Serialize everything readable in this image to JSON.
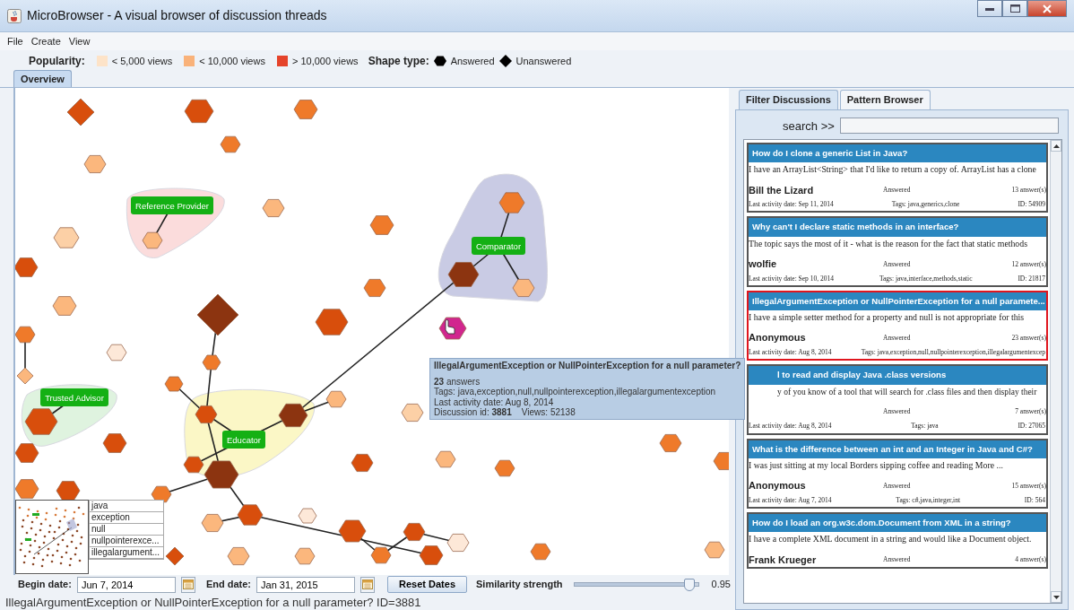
{
  "window": {
    "title": "MicroBrowser - A visual browser of discussion threads"
  },
  "menu": [
    "File",
    "Create",
    "View"
  ],
  "legend": {
    "popularity_label": "Popularity:",
    "popularity": [
      {
        "label": "< 5,000 views",
        "color": "#fde3c8"
      },
      {
        "label": "< 10,000 views",
        "color": "#f9b27a"
      },
      {
        "label": "> 10,000 views",
        "color": "#e5432a"
      }
    ],
    "shape_label": "Shape type:",
    "shapes": [
      {
        "kind": "hexagon",
        "label": "Answered"
      },
      {
        "kind": "diamond",
        "label": "Unanswered"
      }
    ]
  },
  "tabs": [
    {
      "label": "Overview",
      "selected": true
    }
  ],
  "graph": {
    "clusters": [
      {
        "label": "Reference Provider",
        "color": "#fbdcdc"
      },
      {
        "label": "Comparator",
        "color": "#c9cbe4"
      },
      {
        "label": "Educator",
        "color": "#fbf7c6"
      },
      {
        "label": "Trusted Advisor",
        "color": "#dff3df"
      }
    ],
    "nodes": [
      {
        "kind": "diamond",
        "color": "#d84e0c"
      },
      {
        "kind": "hexagon",
        "color": "#d84e0c"
      },
      {
        "kind": "hexagon",
        "color": "#ef7a2a"
      },
      {
        "kind": "hexagon",
        "color": "#ef7a2a"
      },
      {
        "kind": "hexagon",
        "color": "#fbb77d"
      },
      {
        "kind": "hexagon",
        "color": "#fbb77d"
      },
      {
        "kind": "hexagon",
        "color": "#fcd0a6"
      },
      {
        "kind": "hexagon",
        "color": "#fbb77d"
      },
      {
        "kind": "hexagon",
        "color": "#d84e0c"
      },
      {
        "kind": "hexagon",
        "color": "#ef7a2a"
      },
      {
        "kind": "hexagon",
        "color": "#fbb77d"
      },
      {
        "kind": "hexagon",
        "color": "#ef7a2a"
      },
      {
        "kind": "hexagon",
        "color": "#d84e0c"
      },
      {
        "kind": "diamond",
        "color": "#8c3410"
      },
      {
        "kind": "hexagon",
        "color": "#ef7a2a"
      },
      {
        "kind": "hexagon",
        "color": "#8c3410"
      },
      {
        "kind": "hexagon",
        "color": "#fbb77d"
      },
      {
        "kind": "hexagon",
        "color": "#d1268e"
      },
      {
        "kind": "hexagon",
        "color": "#ef7a2a"
      },
      {
        "kind": "diamond",
        "color": "#fbb77d"
      },
      {
        "kind": "hexagon",
        "color": "#fde8d8"
      },
      {
        "kind": "hexagon",
        "color": "#ef7a2a"
      },
      {
        "kind": "hexagon",
        "color": "#ef7a2a"
      },
      {
        "kind": "hexagon",
        "color": "#d84e0c"
      },
      {
        "kind": "hexagon",
        "color": "#d84e0c"
      },
      {
        "kind": "hexagon",
        "color": "#8c3410"
      },
      {
        "kind": "hexagon",
        "color": "#fbb77d"
      },
      {
        "kind": "hexagon",
        "color": "#d84e0c"
      },
      {
        "kind": "hexagon",
        "color": "#d84e0c"
      },
      {
        "kind": "hexagon",
        "color": "#d84e0c"
      },
      {
        "kind": "hexagon",
        "color": "#8c3410"
      },
      {
        "kind": "hexagon",
        "color": "#ef7a2a"
      },
      {
        "kind": "hexagon",
        "color": "#fcd0a6"
      },
      {
        "kind": "hexagon",
        "color": "#d84e0c"
      },
      {
        "kind": "hexagon",
        "color": "#fbb77d"
      },
      {
        "kind": "hexagon",
        "color": "#ef7a2a"
      },
      {
        "kind": "hexagon",
        "color": "#ef7a2a"
      },
      {
        "kind": "hexagon",
        "color": "#ef7a2a"
      },
      {
        "kind": "hexagon",
        "color": "#ef7a2a"
      },
      {
        "kind": "hexagon",
        "color": "#d84e0c"
      },
      {
        "kind": "hexagon",
        "color": "#fbb77d"
      },
      {
        "kind": "hexagon",
        "color": "#d84e0c"
      },
      {
        "kind": "hexagon",
        "color": "#fde8d8"
      },
      {
        "kind": "hexagon",
        "color": "#d84e0c"
      },
      {
        "kind": "hexagon",
        "color": "#d84e0c"
      },
      {
        "kind": "hexagon",
        "color": "#fde8d8"
      },
      {
        "kind": "hexagon",
        "color": "#d84e0c"
      },
      {
        "kind": "hexagon",
        "color": "#ef7a2a"
      },
      {
        "kind": "hexagon",
        "color": "#fbb77d"
      },
      {
        "kind": "hexagon",
        "color": "#fbb77d"
      },
      {
        "kind": "diamond",
        "color": "#d84e0c"
      },
      {
        "kind": "hexagon",
        "color": "#ef7a2a"
      },
      {
        "kind": "hexagon",
        "color": "#fbb77d"
      }
    ]
  },
  "tooltip": {
    "title": "IllegalArgumentException or NullPointerException for a null parameter?",
    "answers": "**23** answers",
    "tags": "Tags: java,exception,null,nullpointerexception,illegalargumentexception",
    "date": "Last activity date: Aug 8, 2014",
    "footer": "Discussion id: **3881**    Views: 52138"
  },
  "tag_list": [
    "java",
    "exception",
    "null",
    "nullpointerexce...",
    "illegalargument..."
  ],
  "date_filter": {
    "begin_label": "Begin date:",
    "begin": "Jun 7, 2014",
    "end_label": "End date:",
    "end": "Jan 31, 2015",
    "reset": "Reset Dates",
    "similarity_label": "Similarity strength",
    "level": 0.93,
    "reading": "0.95"
  },
  "status_bar": "IllegalArgumentException or NullPointerException for a null parameter? ID=3881",
  "side_tabs": [
    {
      "label": "Filter Discussions",
      "selected": true
    },
    {
      "label": "Pattern Browser",
      "selected": false
    }
  ],
  "search": {
    "label": "search >>"
  },
  "discussions": [
    {
      "title": "How do I clone a generic List in Java?",
      "snippet": "I have an ArrayList<String> that I'd like to return a copy of. ArrayList has a clone",
      "author": "Bill the Lizard",
      "status": "Answered",
      "answers": "13 answer(s)",
      "date": "Last activity date: Sep 11, 2014",
      "tags": "Tags: java,generics,clone",
      "id": "ID: 54909",
      "selected": false,
      "partly_hidden": false
    },
    {
      "title": "Why can't I declare static methods in an interface?",
      "snippet": "The topic says the most of it - what is the reason for the fact that static methods",
      "author": "wolfie",
      "status": "Answered",
      "answers": "12 answer(s)",
      "date": "Last activity date: Sep 10, 2014",
      "tags": "Tags: java,interface,methods,static",
      "id": "ID: 21817",
      "selected": false,
      "partly_hidden": false
    },
    {
      "title": "IllegalArgumentException or NullPointerException for a null paramete...",
      "snippet": "I have a simple setter method for a property and null is not appropriate for this",
      "author": "Anonymous",
      "status": "Answered",
      "answers": "23 answer(s)",
      "date": "Last activity date: Aug 8, 2014",
      "tags": "Tags: java,exception,null,nullpointerexception,illegalargumentexcep",
      "selected": true,
      "partly_hidden": false
    },
    {
      "title": "l to read and display Java .class versions",
      "snippet": "y of you know of a tool that will search for .class files and then display their",
      "status": "Answered",
      "answers": "7 answer(s)",
      "date": "Last activity date: Aug 8, 2014",
      "tags": "Tags: java",
      "id": "ID: 27065",
      "selected": false,
      "partly_hidden": true
    },
    {
      "title": "What is the difference between an int and an Integer in Java and C#?",
      "snippet": "I was just sitting at my local Borders sipping coffee and reading More ...",
      "author": "Anonymous",
      "status": "Answered",
      "answers": "15 answer(s)",
      "date": "Last activity date: Aug 7, 2014",
      "tags": "Tags: c#,java,integer,int",
      "id": "ID: 564",
      "selected": false,
      "partly_hidden": false
    },
    {
      "title": "How do I load an org.w3c.dom.Document from XML in a string?",
      "snippet": "I have a complete XML document in a string and would like a Document object.",
      "author": "Frank Krueger",
      "status": "Answered",
      "answers": "4 answer(s)",
      "selected": false,
      "partly_hidden": false
    }
  ]
}
